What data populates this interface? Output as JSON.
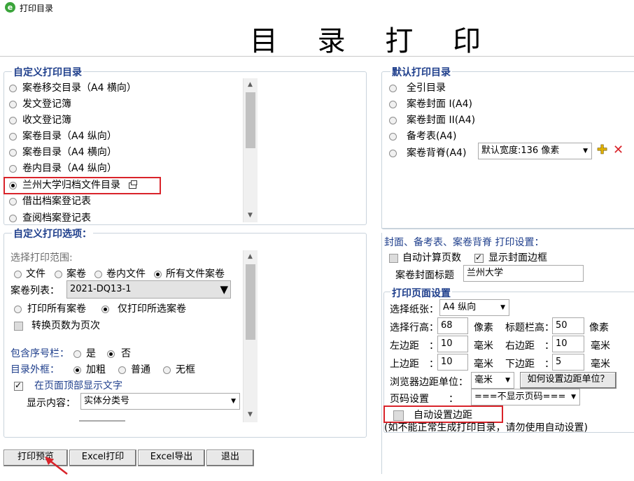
{
  "window": {
    "title": "打印目录",
    "heading": "目 录 打 印"
  },
  "custom_catalog": {
    "title": "自定义打印目录",
    "items": [
      {
        "label": "案卷移交目录（A4 横向）",
        "checked": false
      },
      {
        "label": "发文登记簿",
        "checked": false
      },
      {
        "label": "收文登记簿",
        "checked": false
      },
      {
        "label": "案卷目录（A4 纵向）",
        "checked": false
      },
      {
        "label": "案卷目录（A4 横向）",
        "checked": false
      },
      {
        "label": "卷内目录（A4 纵向）",
        "checked": false
      },
      {
        "label": "兰州大学归档文件目录",
        "checked": true
      },
      {
        "label": "借出档案登记表",
        "checked": false
      },
      {
        "label": "查阅档案登记表",
        "checked": false
      }
    ]
  },
  "default_catalog": {
    "title": "默认打印目录",
    "items": [
      {
        "label": "全引目录",
        "checked": false
      },
      {
        "label": "案卷封面 I(A4)",
        "checked": false
      },
      {
        "label": "案卷封面 II(A4)",
        "checked": false
      },
      {
        "label": "备考表(A4)",
        "checked": false
      },
      {
        "label": "案卷背脊(A4)",
        "checked": false
      }
    ],
    "spine_width": "默认宽度:136 像素"
  },
  "options": {
    "title": "自定义打印选项：",
    "range_label": "选择打印范围:",
    "range_options": [
      {
        "label": "文件",
        "checked": false
      },
      {
        "label": "案卷",
        "checked": false
      },
      {
        "label": "卷内文件",
        "checked": false
      },
      {
        "label": "所有文件案卷",
        "checked": true
      }
    ],
    "volume_list_label": "案卷列表：",
    "volume_list_value": "2021-DQ13-1",
    "print_all": "打印所有案卷",
    "print_selected": "仅打印所选案卷",
    "convert_pages": "转换页数为页次",
    "seq_label": "包含序号栏：",
    "seq_yes": "是",
    "seq_no": "否",
    "border_label": "目录外框：",
    "border_bold": "加粗",
    "border_normal": "普通",
    "border_none": "无框",
    "show_top_text": "在页面顶部显示文字",
    "display_content_label": "显示内容：",
    "display_content_value": "实体分类号"
  },
  "cover": {
    "title": "封面、备考表、案卷背脊 打印设置：",
    "auto_pages": "自动计算页数",
    "show_border": "显示封面边框",
    "cover_title_label": "案卷封面标题",
    "cover_title_value": "兰州大学"
  },
  "page_setup": {
    "title": "打印页面设置",
    "paper_label": "选择纸张：",
    "paper_value": "A4 纵向",
    "row_height_label": "选择行高：",
    "row_height_value": "68",
    "unit_px": "像素",
    "title_height_label": "标题栏高：",
    "title_height_value": "50",
    "left_margin_label": "左边距　：",
    "left_margin_value": "10",
    "right_margin_label": "右边距　：",
    "right_margin_value": "10",
    "top_margin_label": "上边距　：",
    "top_margin_value": "10",
    "bottom_margin_label": "下边距　：",
    "bottom_margin_value": "5",
    "unit_mm": "毫米",
    "browser_unit_label": "浏览器边距单位：",
    "browser_unit_value": "毫米",
    "how_set_button": "如何设置边距单位？",
    "page_number_label": "页码设置　　：",
    "page_number_value": "===不显示页码===",
    "auto_margin": "自动设置边距",
    "auto_margin_note": "(如不能正常生成打印目录，请勿使用自动设置)"
  },
  "buttons": {
    "preview": "打印预览",
    "excel_print": "Excel打印",
    "excel_export": "Excel导出",
    "exit": "退出"
  },
  "colors": {
    "highlight": "#d9232a",
    "group_title": "#1f3f8c"
  }
}
